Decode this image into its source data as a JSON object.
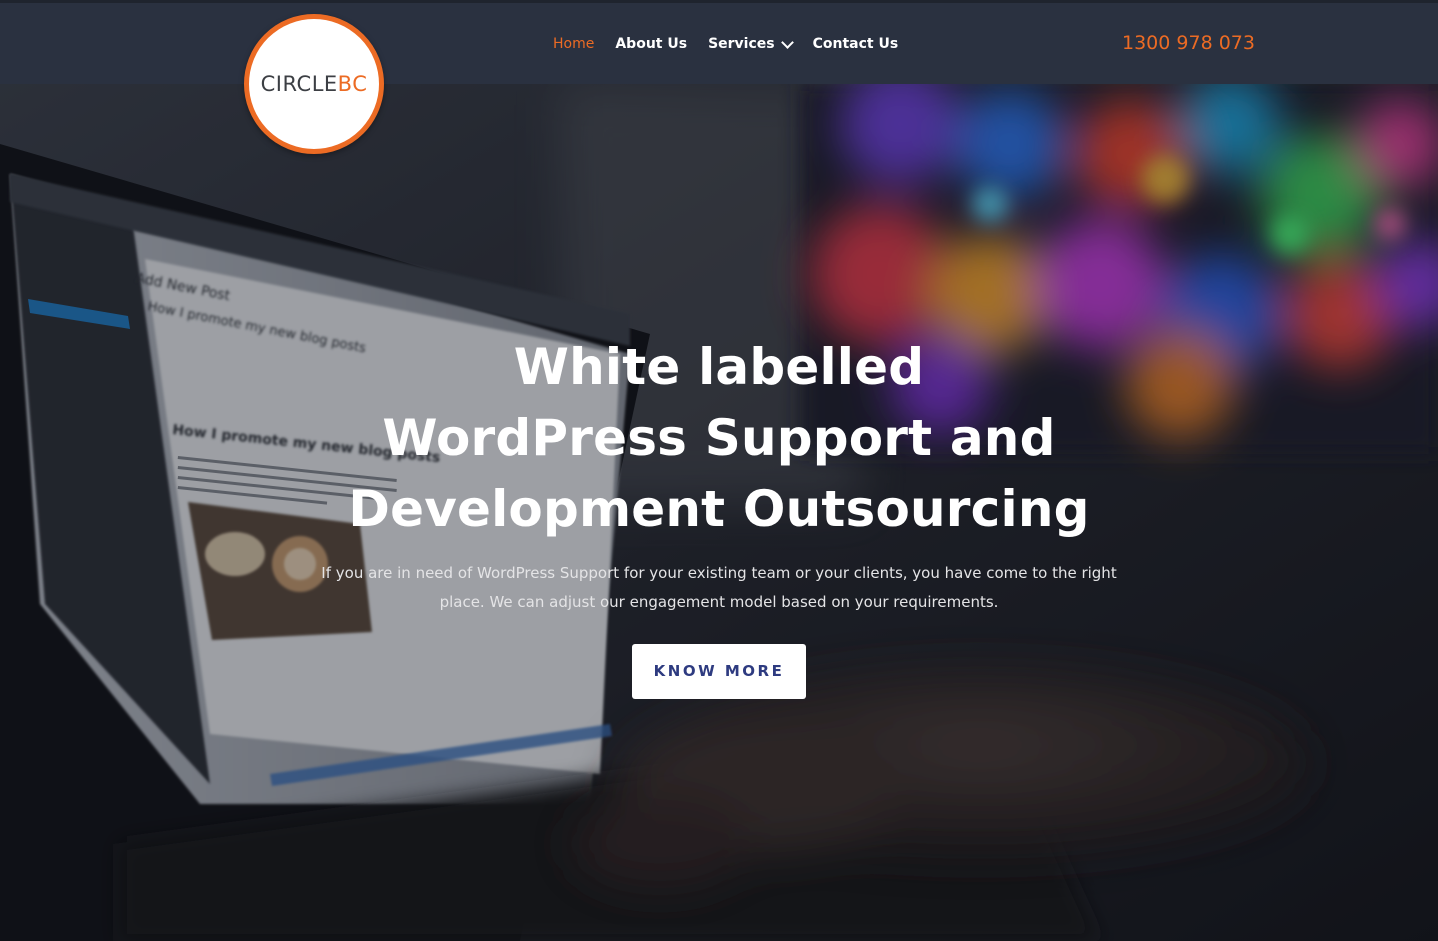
{
  "header": {
    "logo": {
      "part1": "CIRCLE",
      "part2": "BC"
    },
    "nav": [
      {
        "label": "Home",
        "active": true
      },
      {
        "label": "About Us"
      },
      {
        "label": "Services",
        "has_dropdown": true
      },
      {
        "label": "Contact Us"
      }
    ],
    "phone": "1300 978 073"
  },
  "hero": {
    "title_lines": [
      "White labelled",
      "WordPress Support and",
      "Development Outsourcing"
    ],
    "subtitle": "If you are in need of WordPress Support for your existing team or your clients, you have come to the right place. We can adjust our engagement model based on your requirements.",
    "cta_label": "KNOW MORE",
    "background_description_icon": "laptop-wordpress-editor-photo"
  },
  "colors": {
    "accent": "#ec6b24",
    "header_bg": "#2a3140",
    "cta_text": "#2e3b80"
  }
}
